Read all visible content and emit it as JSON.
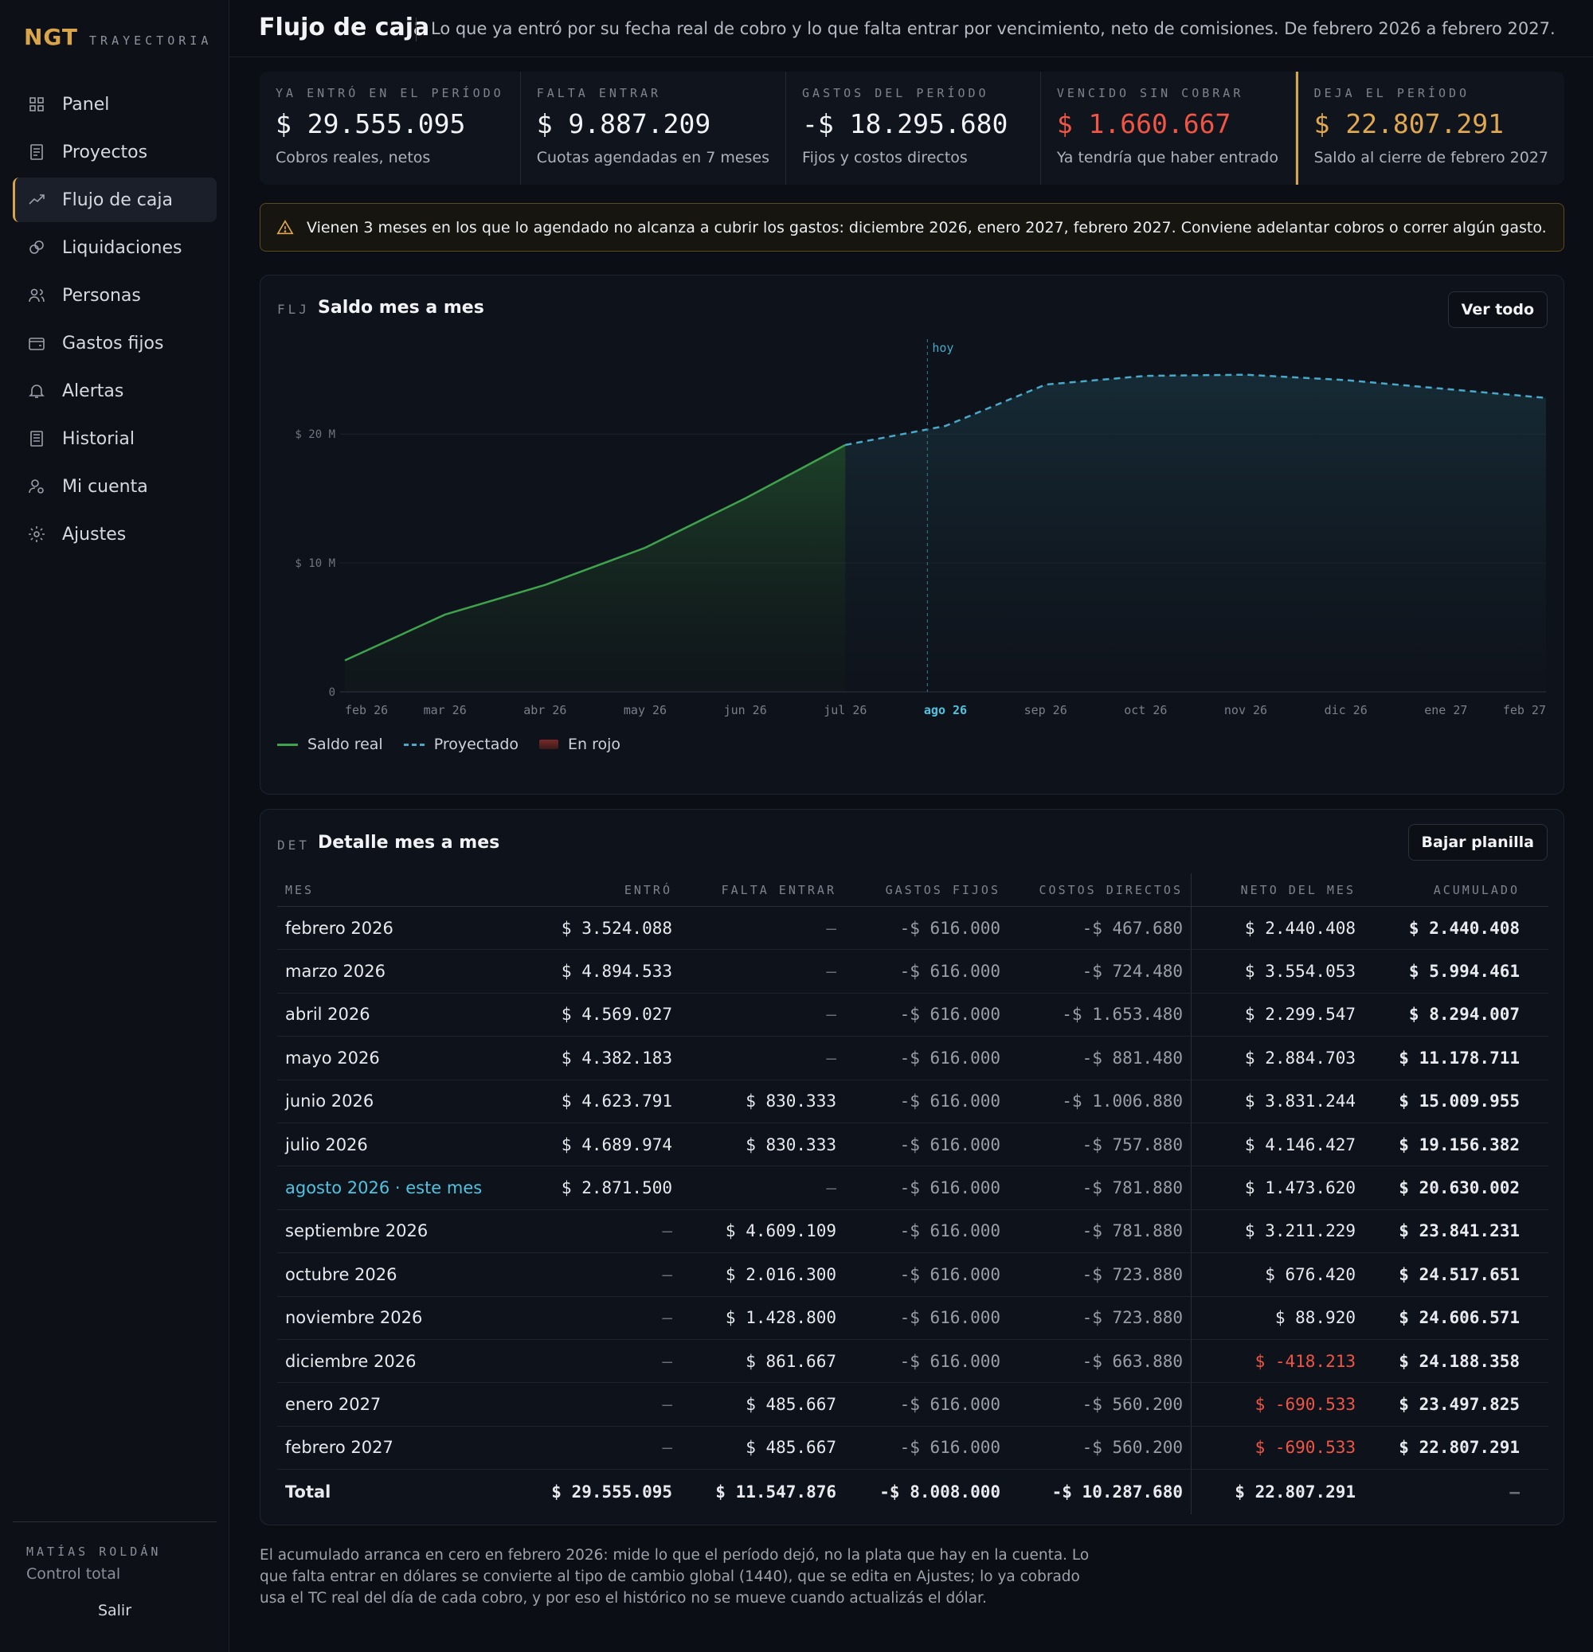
{
  "brand": {
    "logo": "NGT",
    "subtitle": "TRAYECTORIA"
  },
  "nav": [
    {
      "label": "Panel",
      "icon": "grid-icon"
    },
    {
      "label": "Proyectos",
      "icon": "document-icon"
    },
    {
      "label": "Flujo de caja",
      "icon": "trend-icon",
      "active": true
    },
    {
      "label": "Liquidaciones",
      "icon": "coins-icon"
    },
    {
      "label": "Personas",
      "icon": "people-icon"
    },
    {
      "label": "Gastos fijos",
      "icon": "wallet-icon"
    },
    {
      "label": "Alertas",
      "icon": "bell-icon"
    },
    {
      "label": "Historial",
      "icon": "history-icon"
    },
    {
      "label": "Mi cuenta",
      "icon": "user-icon"
    },
    {
      "label": "Ajustes",
      "icon": "gear-icon"
    }
  ],
  "user": {
    "name": "MATÍAS ROLDÁN",
    "role": "Control total",
    "logout": "Salir"
  },
  "header": {
    "title": "Flujo de caja",
    "description": "Lo que ya entró por su fecha real de cobro y lo que falta entrar por vencimiento, neto de comisiones. De febrero 2026 a febrero 2027."
  },
  "kpis": [
    {
      "label": "YA ENTRÓ EN EL PERÍODO",
      "value": "$ 29.555.095",
      "sub": "Cobros reales, netos",
      "tone": "normal"
    },
    {
      "label": "FALTA ENTRAR",
      "value": "$ 9.887.209",
      "sub": "Cuotas agendadas en 7 meses",
      "tone": "normal"
    },
    {
      "label": "GASTOS DEL PERÍODO",
      "value": "-$ 18.295.680",
      "sub": "Fijos y costos directos",
      "tone": "normal"
    },
    {
      "label": "VENCIDO SIN COBRAR",
      "value": "$ 1.660.667",
      "sub": "Ya tendría que haber entrado",
      "tone": "red"
    },
    {
      "label": "DEJA EL PERÍODO",
      "value": "$ 22.807.291",
      "sub": "Saldo al cierre de febrero 2027",
      "tone": "gold"
    }
  ],
  "warning": "Vienen 3 meses en los que lo agendado no alcanza a cubrir los gastos: diciembre 2026, enero 2027, febrero 2027. Conviene adelantar cobros o correr algún gasto.",
  "chart_card": {
    "code": "FLJ",
    "title": "Saldo mes a mes",
    "button": "Ver todo"
  },
  "chart_data": {
    "type": "area",
    "categories": [
      "feb 26",
      "mar 26",
      "abr 26",
      "may 26",
      "jun 26",
      "jul 26",
      "ago 26",
      "sep 26",
      "oct 26",
      "nov 26",
      "dic 26",
      "ene 27",
      "feb 27"
    ],
    "values": [
      2440408,
      5994461,
      8294007,
      11178711,
      15009955,
      19156382,
      20630002,
      23841231,
      24517651,
      24606571,
      24188358,
      23497825,
      22807291
    ],
    "series": [
      {
        "name": "Saldo real",
        "from": 0,
        "to": 5,
        "style": "solid",
        "color": "#3fa34d"
      },
      {
        "name": "Proyectado",
        "from": 5,
        "to": 12,
        "style": "dashed",
        "color": "#4aa8c8"
      }
    ],
    "legend_extra": "En rojo",
    "y_ticks": [
      {
        "value": 0,
        "label": "0"
      },
      {
        "value": 10000000,
        "label": "$ 10 M"
      },
      {
        "value": 20000000,
        "label": "$ 20 M"
      }
    ],
    "ylim": [
      0,
      26500000
    ],
    "today_index": 6,
    "today_label": "hoy",
    "grid": true,
    "legend_position": "bottom-left"
  },
  "table_card": {
    "code": "DET",
    "title": "Detalle mes a mes",
    "button": "Bajar planilla"
  },
  "table": {
    "headers": [
      "MES",
      "ENTRÓ",
      "FALTA ENTRAR",
      "GASTOS FIJOS",
      "COSTOS DIRECTOS",
      "NETO DEL MES",
      "ACUMULADO"
    ],
    "rows": [
      {
        "mes": "febrero 2026",
        "entro": "$ 3.524.088",
        "falta": "—",
        "fijos": "-$ 616.000",
        "dir": "-$ 467.680",
        "neto": "$ 2.440.408",
        "acum": "$ 2.440.408"
      },
      {
        "mes": "marzo 2026",
        "entro": "$ 4.894.533",
        "falta": "—",
        "fijos": "-$ 616.000",
        "dir": "-$ 724.480",
        "neto": "$ 3.554.053",
        "acum": "$ 5.994.461"
      },
      {
        "mes": "abril 2026",
        "entro": "$ 4.569.027",
        "falta": "—",
        "fijos": "-$ 616.000",
        "dir": "-$ 1.653.480",
        "neto": "$ 2.299.547",
        "acum": "$ 8.294.007"
      },
      {
        "mes": "mayo 2026",
        "entro": "$ 4.382.183",
        "falta": "—",
        "fijos": "-$ 616.000",
        "dir": "-$ 881.480",
        "neto": "$ 2.884.703",
        "acum": "$ 11.178.711"
      },
      {
        "mes": "junio 2026",
        "entro": "$ 4.623.791",
        "falta": "$ 830.333",
        "fijos": "-$ 616.000",
        "dir": "-$ 1.006.880",
        "neto": "$ 3.831.244",
        "acum": "$ 15.009.955"
      },
      {
        "mes": "julio 2026",
        "entro": "$ 4.689.974",
        "falta": "$ 830.333",
        "fijos": "-$ 616.000",
        "dir": "-$ 757.880",
        "neto": "$ 4.146.427",
        "acum": "$ 19.156.382"
      },
      {
        "mes": "agosto 2026 · este mes",
        "entro": "$ 2.871.500",
        "falta": "—",
        "fijos": "-$ 616.000",
        "dir": "-$ 781.880",
        "neto": "$ 1.473.620",
        "acum": "$ 20.630.002",
        "current": true
      },
      {
        "mes": "septiembre 2026",
        "entro": "—",
        "falta": "$ 4.609.109",
        "fijos": "-$ 616.000",
        "dir": "-$ 781.880",
        "neto": "$ 3.211.229",
        "acum": "$ 23.841.231"
      },
      {
        "mes": "octubre 2026",
        "entro": "—",
        "falta": "$ 2.016.300",
        "fijos": "-$ 616.000",
        "dir": "-$ 723.880",
        "neto": "$ 676.420",
        "acum": "$ 24.517.651"
      },
      {
        "mes": "noviembre 2026",
        "entro": "—",
        "falta": "$ 1.428.800",
        "fijos": "-$ 616.000",
        "dir": "-$ 723.880",
        "neto": "$ 88.920",
        "acum": "$ 24.606.571"
      },
      {
        "mes": "diciembre 2026",
        "entro": "—",
        "falta": "$ 861.667",
        "fijos": "-$ 616.000",
        "dir": "-$ 663.880",
        "neto": "$ -418.213",
        "acum": "$ 24.188.358",
        "negative": true
      },
      {
        "mes": "enero 2027",
        "entro": "—",
        "falta": "$ 485.667",
        "fijos": "-$ 616.000",
        "dir": "-$ 560.200",
        "neto": "$ -690.533",
        "acum": "$ 23.497.825",
        "negative": true
      },
      {
        "mes": "febrero 2027",
        "entro": "—",
        "falta": "$ 485.667",
        "fijos": "-$ 616.000",
        "dir": "-$ 560.200",
        "neto": "$ -690.533",
        "acum": "$ 22.807.291",
        "negative": true
      }
    ],
    "total": {
      "mes": "Total",
      "entro": "$ 29.555.095",
      "falta": "$ 11.547.876",
      "fijos": "-$ 8.008.000",
      "dir": "-$ 10.287.680",
      "neto": "$ 22.807.291",
      "acum": "—"
    }
  },
  "footnote": "El acumulado arranca en cero en febrero 2026: mide lo que el período dejó, no la plata que hay en la cuenta. Lo que falta entrar en dólares se convierte al tipo de cambio global (1440), que se edita en Ajustes; lo ya cobrado usa el TC real del día de cada cobro, y por eso el histórico no se mueve cuando actualizás el dólar."
}
